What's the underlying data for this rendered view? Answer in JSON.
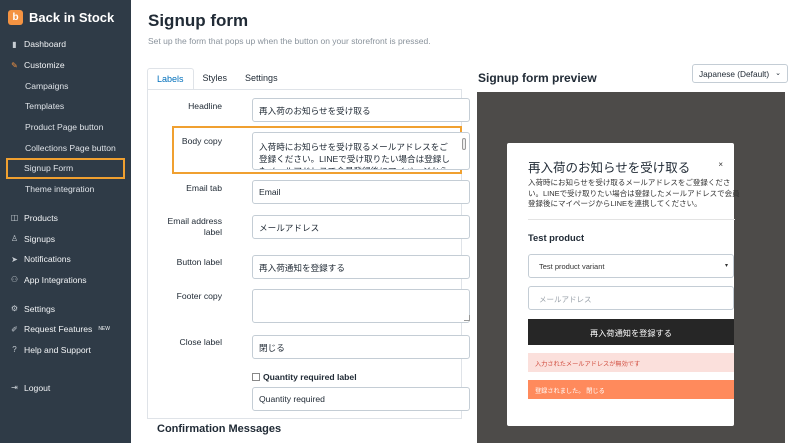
{
  "app": {
    "name": "Back in Stock",
    "logo_glyph": "b",
    "logo_color": "#f49342"
  },
  "sidebar": {
    "items": [
      {
        "label": "Dashboard",
        "icon": "chart-icon"
      },
      {
        "label": "Customize",
        "icon": "brush-icon"
      },
      {
        "label": "Campaigns",
        "sub": true
      },
      {
        "label": "Templates",
        "sub": true
      },
      {
        "label": "Product Page button",
        "sub": true
      },
      {
        "label": "Collections Page button",
        "sub": true
      },
      {
        "label": "Signup Form",
        "sub": true,
        "active": true
      },
      {
        "label": "Theme integration",
        "sub": true
      },
      {
        "label": "Products",
        "icon": "box-icon"
      },
      {
        "label": "Signups",
        "icon": "user-plus-icon"
      },
      {
        "label": "Notifications",
        "icon": "send-icon"
      },
      {
        "label": "App Integrations",
        "icon": "plug-icon"
      },
      {
        "label": "Settings",
        "icon": "gear-icon"
      },
      {
        "label": "Request Features",
        "icon": "pencil-icon",
        "badge": "NEW"
      },
      {
        "label": "Help and Support",
        "icon": "help-icon"
      },
      {
        "label": "Logout",
        "icon": "logout-icon"
      }
    ],
    "highlight_color": "#f0a030"
  },
  "page": {
    "title": "Signup form",
    "subtitle": "Set up the form that pops up when the button on your storefront is pressed."
  },
  "tabs": [
    {
      "label": "Labels",
      "active": true
    },
    {
      "label": "Styles"
    },
    {
      "label": "Settings"
    }
  ],
  "form": {
    "headline": {
      "label": "Headline",
      "value": "再入荷のお知らせを受け取る"
    },
    "body_copy": {
      "label": "Body copy",
      "value": "入荷時にお知らせを受け取るメールアドレスをご登録ください。LINEで受け取りたい場合は登録したメールアドレスで会員登録後にマイページからLINE"
    },
    "email_tab": {
      "label": "Email tab",
      "value": "Email"
    },
    "email_address_label": {
      "label": "Email address label",
      "value": "メールアドレス"
    },
    "button_label": {
      "label": "Button label",
      "value": "再入荷通知を登録する"
    },
    "footer_copy": {
      "label": "Footer copy",
      "value": ""
    },
    "close_label": {
      "label": "Close label",
      "value": "閉じる"
    },
    "quantity_required": {
      "checkbox_label": "Quantity required label",
      "checked": false,
      "value": "Quantity required"
    },
    "confirmation_title": "Confirmation Messages"
  },
  "preview": {
    "title": "Signup form preview",
    "language": "Japanese (Default)",
    "background": "#4d4b49",
    "modal": {
      "headline": "再入荷のお知らせを受け取る",
      "close": "×",
      "body": "入荷時にお知らせを受け取るメールアドレスをご登録ください。LINEで受け取りたい場合は登録したメールアドレスで会員登録後にマイページからLINEを連携してください。",
      "product": "Test product",
      "variant": "Test product variant",
      "email_placeholder": "メールアドレス",
      "submit": "再入荷通知を登録する",
      "error": "入力されたメールアドレスが無効です",
      "success": "登録されました。 閉じる",
      "error_bg": "#fbe0dc",
      "success_bg": "#ff8a5c"
    }
  }
}
